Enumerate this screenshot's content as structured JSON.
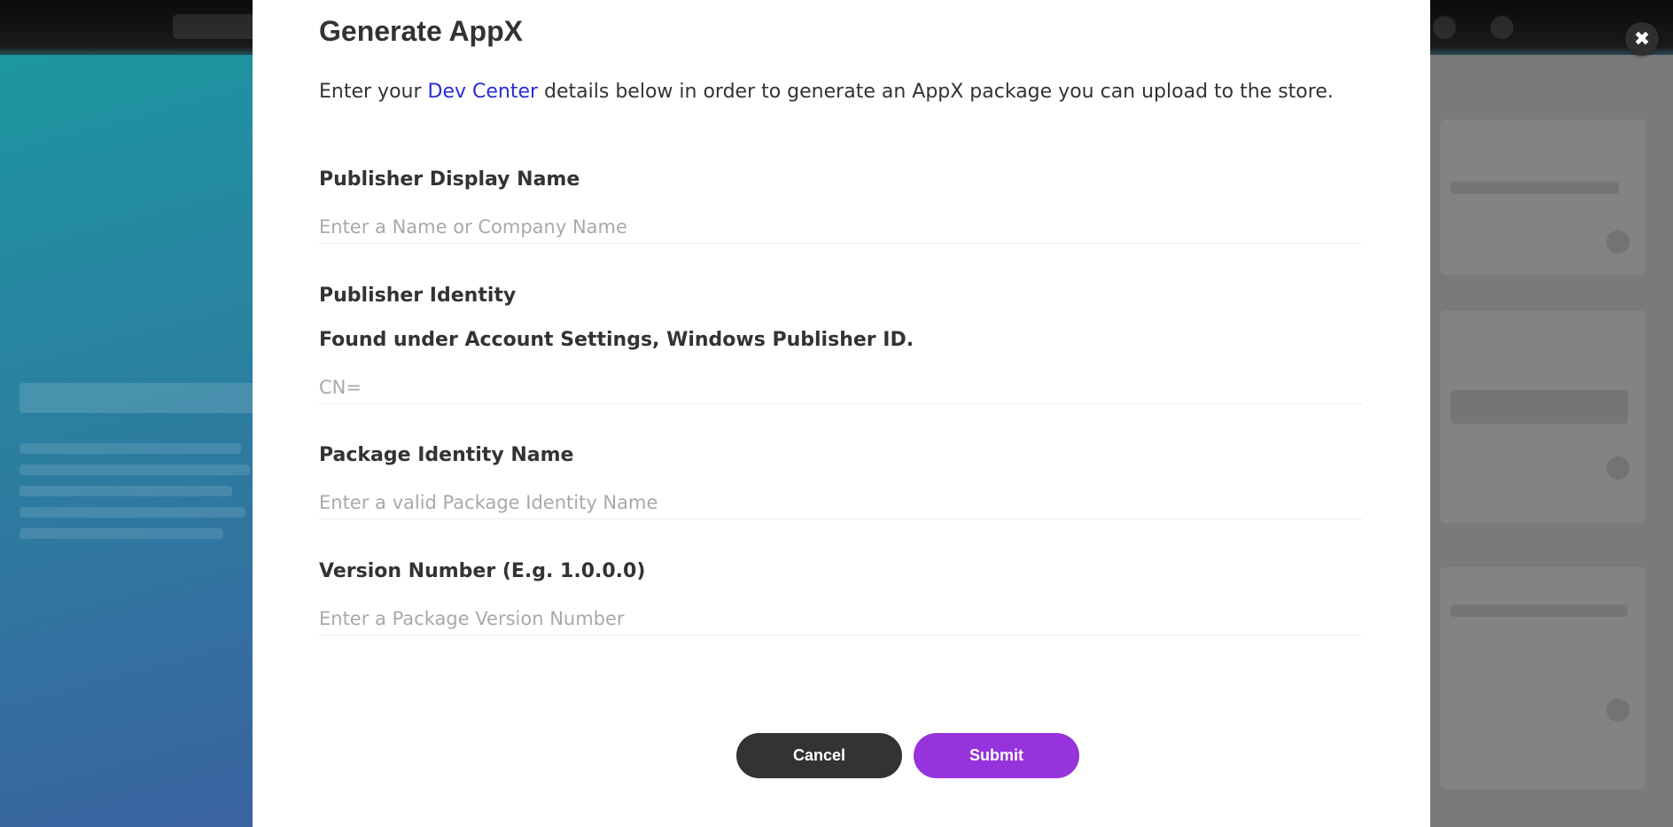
{
  "colors": {
    "link": "#2a2ad6",
    "submit": "#9733dc",
    "cancel": "#333333",
    "placeholder": "#a9a9a9",
    "text": "#333333"
  },
  "close_button": {
    "glyph": "✖",
    "icon": "close-icon"
  },
  "modal": {
    "title": "Generate AppX",
    "intro": {
      "before": "Enter your ",
      "link": "Dev Center",
      "after": " details below in order to generate an AppX package you can upload to the store."
    },
    "fields": [
      {
        "label": "Publisher Display Name",
        "placeholder": "Enter a Name or Company Name",
        "value": ""
      },
      {
        "label": "Publisher Identity",
        "sublabel": "Found under Account Settings, Windows Publisher ID.",
        "placeholder": "CN=",
        "value": ""
      },
      {
        "label": "Package Identity Name",
        "placeholder": "Enter a valid Package Identity Name",
        "value": ""
      },
      {
        "label": "Version Number (E.g. 1.0.0.0)",
        "placeholder": "Enter a Package Version Number",
        "value": ""
      }
    ],
    "cancel_label": "Cancel",
    "submit_label": "Submit"
  }
}
